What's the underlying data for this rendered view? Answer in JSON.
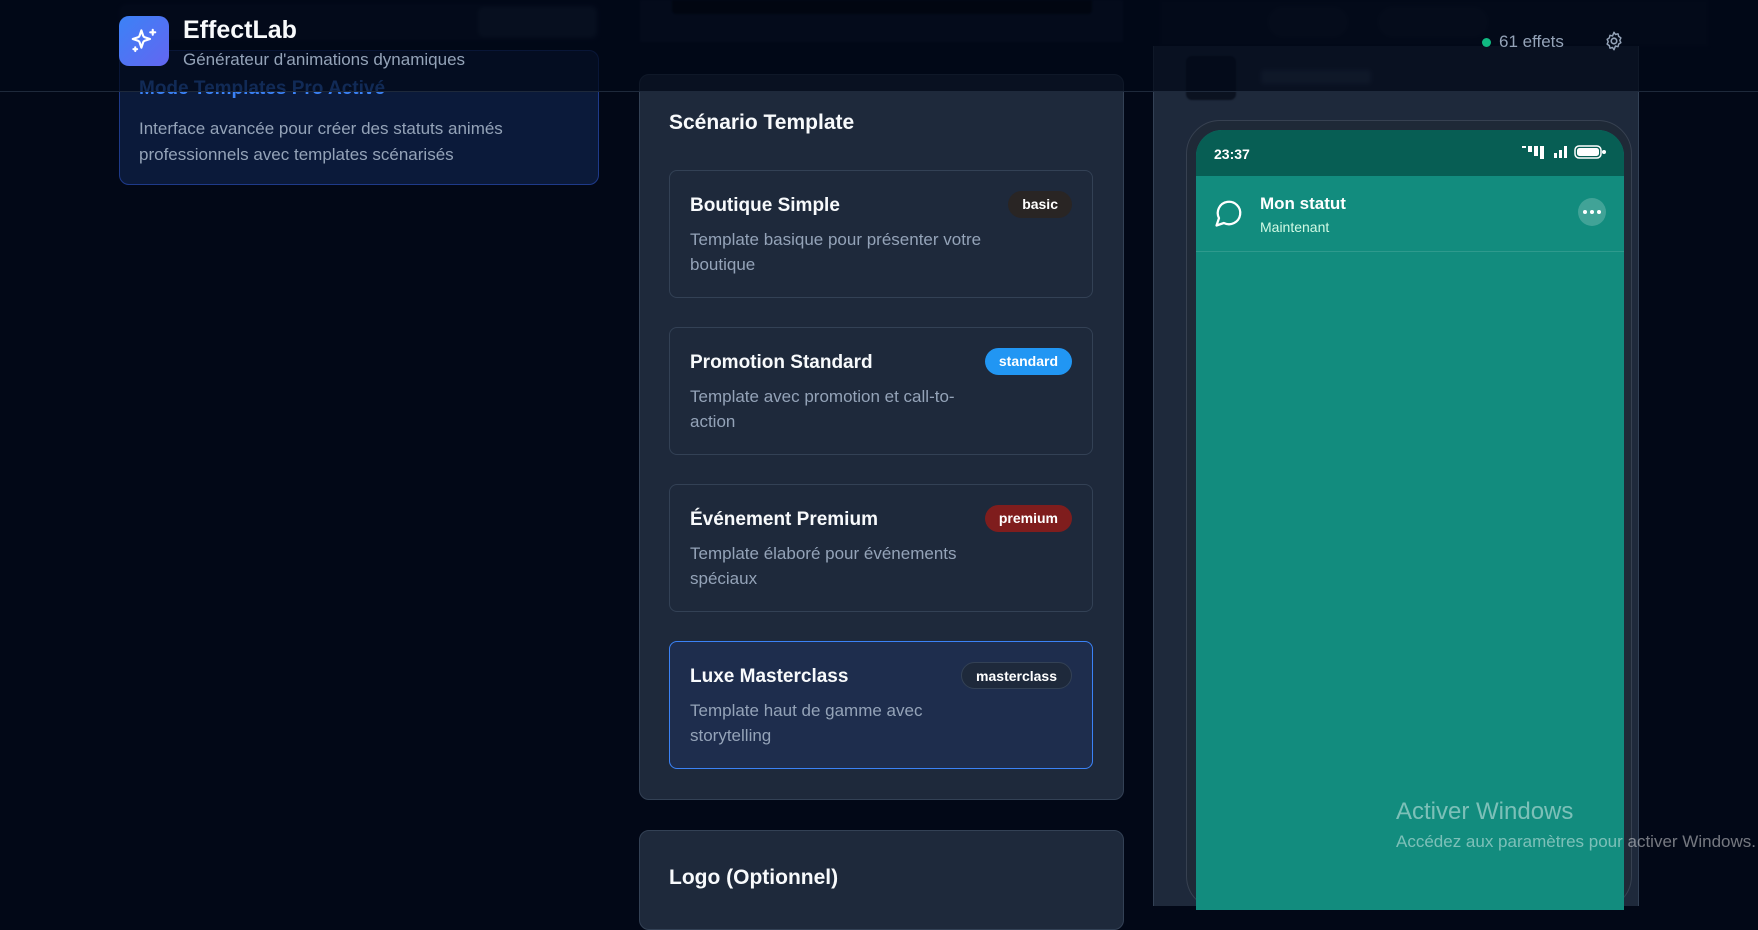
{
  "header": {
    "brand": "EffectLab",
    "tagline": "Générateur d'animations dynamiques",
    "effects_count": "61 effets"
  },
  "left_panel": {
    "title": "Mode Templates Pro Activé",
    "description": "Interface avancée pour créer des statuts animés professionnels avec templates scénarisés"
  },
  "scenario": {
    "title": "Scénario Template",
    "templates": [
      {
        "name": "Boutique Simple",
        "description": "Template basique pour présenter votre boutique",
        "badge": "basic",
        "badge_color": "#292524"
      },
      {
        "name": "Promotion Standard",
        "description": "Template avec promotion et call-to-action",
        "badge": "standard",
        "badge_color": "#2196f3"
      },
      {
        "name": "Événement Premium",
        "description": "Template élaboré pour événements spéciaux",
        "badge": "premium",
        "badge_color": "#7f1d1d"
      },
      {
        "name": "Luxe Masterclass",
        "description": "Template haut de gamme avec storytelling",
        "badge": "masterclass",
        "badge_color": "#1e293b",
        "selected": true
      }
    ]
  },
  "logo_section": {
    "title": "Logo (Optionnel)"
  },
  "phone": {
    "time": "23:37",
    "status_title": "Mon statut",
    "status_subtitle": "Maintenant"
  },
  "watermark": {
    "line1": "Activer Windows",
    "line2": "Accédez aux paramètres pour activer Windows."
  },
  "colors": {
    "accent": "#3b82f6",
    "whatsapp_dark": "#075e54",
    "whatsapp": "#128c7e",
    "online": "#10b981"
  }
}
